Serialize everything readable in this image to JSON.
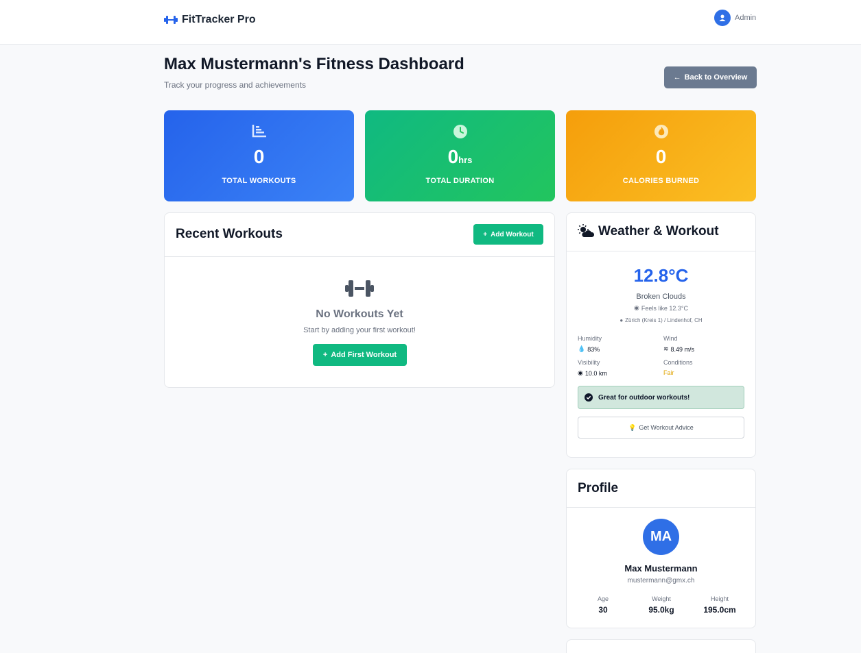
{
  "app": {
    "brand": "FitTracker Pro",
    "user": "Admin"
  },
  "header": {
    "title": "Max Mustermann's Fitness Dashboard",
    "subtitle": "Track your progress and achievements",
    "back_label": "Back to Overview"
  },
  "stats": [
    {
      "value": "0",
      "unit": "",
      "label": "TOTAL WORKOUTS",
      "icon": "chart-icon"
    },
    {
      "value": "0",
      "unit": "hrs",
      "label": "TOTAL DURATION",
      "icon": "clock-icon"
    },
    {
      "value": "0",
      "unit": "",
      "label": "CALORIES BURNED",
      "icon": "fire-icon"
    }
  ],
  "recent": {
    "title": "Recent Workouts",
    "add_label": "Add Workout",
    "empty_title": "No Workouts Yet",
    "empty_sub": "Start by adding your first workout!",
    "first_label": "Add First Workout"
  },
  "weather": {
    "title": "Weather & Workout",
    "temp": "12.8°C",
    "condition": "Broken Clouds",
    "feels": "Feels like 12.3°C",
    "location": "Zürich (Kreis 1) / Lindenhof, CH",
    "humidity_label": "Humidity",
    "humidity": "83%",
    "wind_label": "Wind",
    "wind": "8.49 m/s",
    "visibility_label": "Visibility",
    "visibility": "10.0 km",
    "conditions_label": "Conditions",
    "conditions": "Fair",
    "advice": "Great for outdoor workouts!",
    "advice_btn": "Get Workout Advice"
  },
  "profile": {
    "title": "Profile",
    "initials": "MA",
    "name": "Max Mustermann",
    "email": "mustermann@gmx.ch",
    "age_label": "Age",
    "age": "30",
    "weight_label": "Weight",
    "weight": "95.0kg",
    "height_label": "Height",
    "height": "195.0cm"
  },
  "colors": {
    "primary": "#2563eb",
    "success": "#10b981",
    "warning": "#f59e0b",
    "secondary": "#6b7a90"
  }
}
